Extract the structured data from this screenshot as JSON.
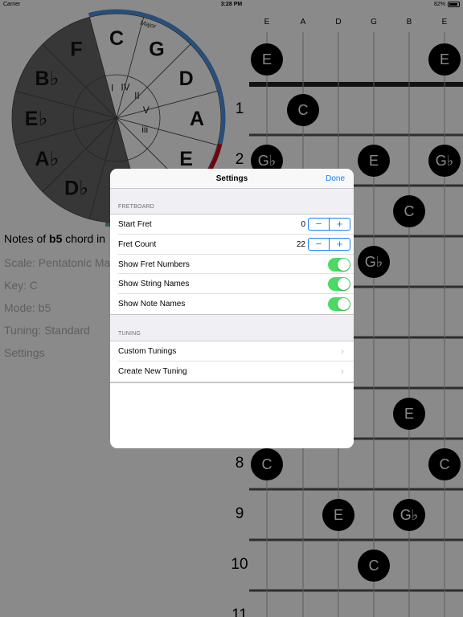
{
  "status_bar": {
    "carrier": "Carrier",
    "time": "3:28 PM",
    "battery": "82%"
  },
  "circle_of_fifths": {
    "notes": [
      "C",
      "G",
      "D",
      "A",
      "E",
      "F",
      "B♭",
      "E♭",
      "A♭",
      "D♭"
    ],
    "partial_note": "G",
    "numerals": [
      "I",
      "IV",
      "II",
      "V",
      "iii"
    ],
    "arc_label": "Major"
  },
  "info": {
    "heading_prefix": "Notes of",
    "chord": "b5",
    "heading_suffix": "chord in",
    "scale": "Scale: Pentatonic Ma",
    "key": "Key: C",
    "mode": "Mode: b5",
    "tuning": "Tuning: Standard",
    "settings": "Settings"
  },
  "fretboard": {
    "strings": [
      "E",
      "A",
      "D",
      "G",
      "B",
      "E"
    ],
    "fret_numbers": [
      "1",
      "2",
      "8",
      "9",
      "10",
      "11"
    ],
    "notes": [
      {
        "label": "E",
        "string": 1,
        "fret": 0
      },
      {
        "label": "E",
        "string": 6,
        "fret": 0
      },
      {
        "label": "C",
        "string": 2,
        "fret": 1
      },
      {
        "label": "G♭",
        "string": 1,
        "fret": 2
      },
      {
        "label": "E",
        "string": 4,
        "fret": 2
      },
      {
        "label": "G♭",
        "string": 6,
        "fret": 2
      },
      {
        "label": "C",
        "string": 5,
        "fret": 3
      },
      {
        "label": "G♭",
        "string": 4,
        "fret": 4
      },
      {
        "label": "E",
        "string": 5,
        "fret": 7
      },
      {
        "label": "C",
        "string": 1,
        "fret": 8
      },
      {
        "label": "C",
        "string": 6,
        "fret": 8
      },
      {
        "label": "E",
        "string": 3,
        "fret": 9
      },
      {
        "label": "G♭",
        "string": 5,
        "fret": 9
      },
      {
        "label": "C",
        "string": 4,
        "fret": 10
      }
    ]
  },
  "settings": {
    "title": "Settings",
    "done": "Done",
    "fretboard_section": "FRETBOARD",
    "start_fret_label": "Start Fret",
    "start_fret_value": "0",
    "fret_count_label": "Fret Count",
    "fret_count_value": "22",
    "stepper_minus": "−",
    "stepper_plus": "+",
    "show_fret_numbers": "Show Fret Numbers",
    "show_fret_numbers_on": true,
    "show_string_names": "Show String Names",
    "show_string_names_on": true,
    "show_note_names": "Show Note Names",
    "show_note_names_on": true,
    "tuning_section": "TUNING",
    "custom_tunings": "Custom Tunings",
    "create_new_tuning": "Create New Tuning",
    "chevron": "›"
  },
  "colors": {
    "accent": "#147efb",
    "toggle_on": "#4cd964",
    "arc_blue": "#4a90e2",
    "arc_red": "#d0021b",
    "arc_green": "#4caf7d",
    "dark_sector": "#666666"
  }
}
